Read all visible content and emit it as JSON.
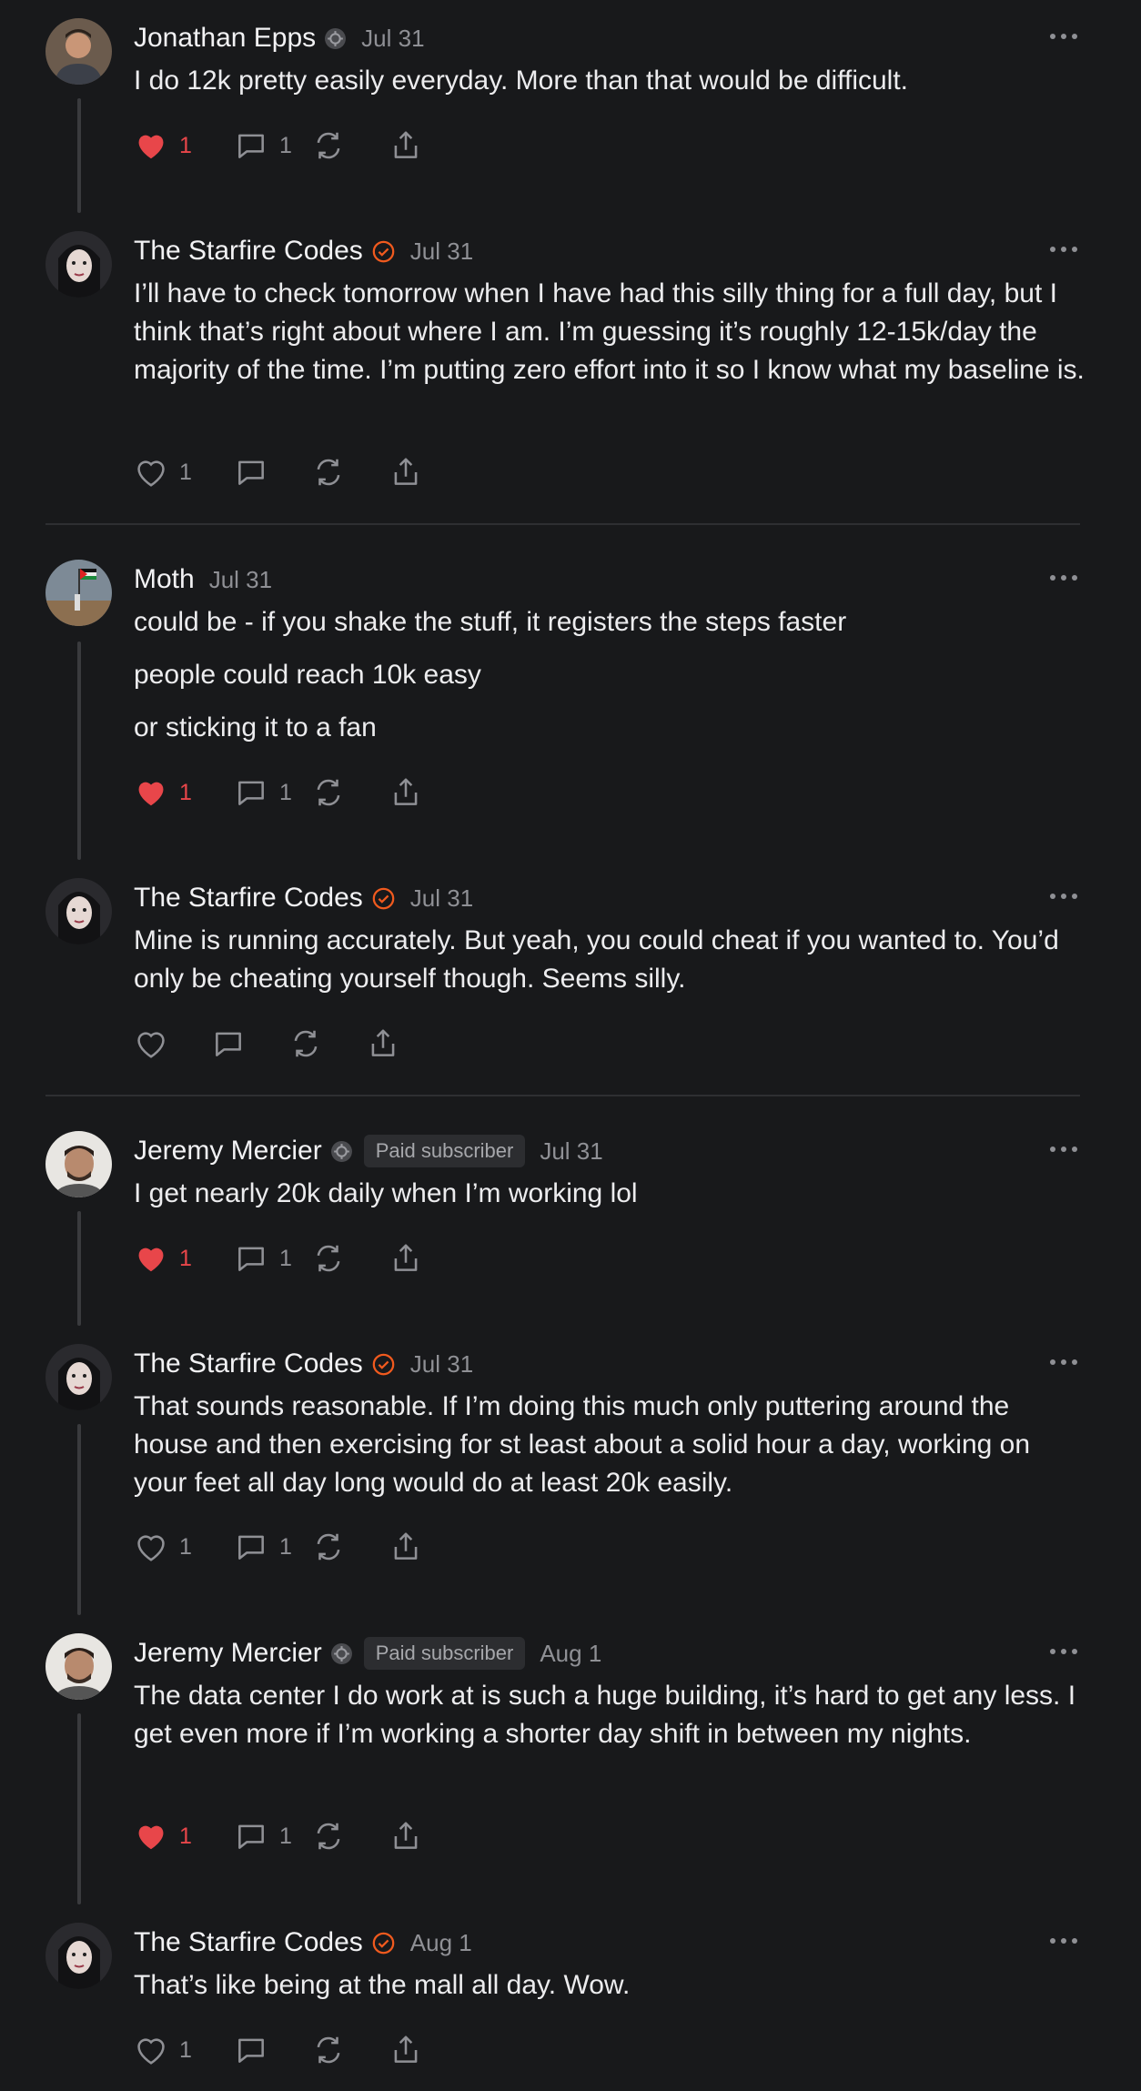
{
  "colors": {
    "background": "#18191b",
    "like_active": "#e8464a",
    "verified": "#f05a1e",
    "muted": "#8f9095"
  },
  "comments": [
    {
      "author": "Jonathan Epps",
      "badge_icon": "member-icon",
      "date": "Jul 31",
      "paragraphs": [
        "I do 12k pretty easily everyday. More than that would be difficult."
      ],
      "likes": "1",
      "liked": true,
      "replies": "1"
    },
    {
      "author": "The Starfire Codes",
      "badge_icon": "verified-icon",
      "date": "Jul 31",
      "paragraphs": [
        "I’ll have to check tomorrow when I have had this silly thing for a full day, but I think that’s right about where I am. I’m guessing it’s roughly 12-15k/day the majority of the time. I’m putting zero effort into it so I know what my baseline is."
      ],
      "likes": "1",
      "liked": false,
      "replies": ""
    },
    {
      "author": "Moth",
      "badge_icon": "",
      "date": "Jul 31",
      "paragraphs": [
        "could be - if you shake the stuff, it registers the steps faster",
        "people could reach 10k easy",
        "or sticking it to a fan"
      ],
      "likes": "1",
      "liked": true,
      "replies": "1"
    },
    {
      "author": "The Starfire Codes",
      "badge_icon": "verified-icon",
      "date": "Jul 31",
      "paragraphs": [
        "Mine is running accurately. But yeah, you could cheat if you wanted to. You’d only be cheating yourself though. Seems silly."
      ],
      "likes": "",
      "liked": false,
      "replies": ""
    },
    {
      "author": "Jeremy Mercier",
      "badge_icon": "member-icon",
      "badge_label": "Paid subscriber",
      "date": "Jul 31",
      "paragraphs": [
        "I get nearly 20k daily when I’m working lol"
      ],
      "likes": "1",
      "liked": true,
      "replies": "1"
    },
    {
      "author": "The Starfire Codes",
      "badge_icon": "verified-icon",
      "date": "Jul 31",
      "paragraphs": [
        "That sounds reasonable. If I’m doing this much only puttering around the house and then exercising for st least about a solid hour a day, working on your feet all day long would do at least 20k easily."
      ],
      "likes": "1",
      "liked": false,
      "replies": "1"
    },
    {
      "author": "Jeremy Mercier",
      "badge_icon": "member-icon",
      "badge_label": "Paid subscriber",
      "date": "Aug 1",
      "paragraphs": [
        "The data center I do work at is such a huge building, it’s hard to get any less. I get even more if I’m working a shorter day shift in between my nights."
      ],
      "likes": "1",
      "liked": true,
      "replies": "1"
    },
    {
      "author": "The Starfire Codes",
      "badge_icon": "verified-icon",
      "date": "Aug 1",
      "paragraphs": [
        "That’s like being at the mall all day. Wow."
      ],
      "likes": "1",
      "liked": false,
      "replies": ""
    }
  ]
}
